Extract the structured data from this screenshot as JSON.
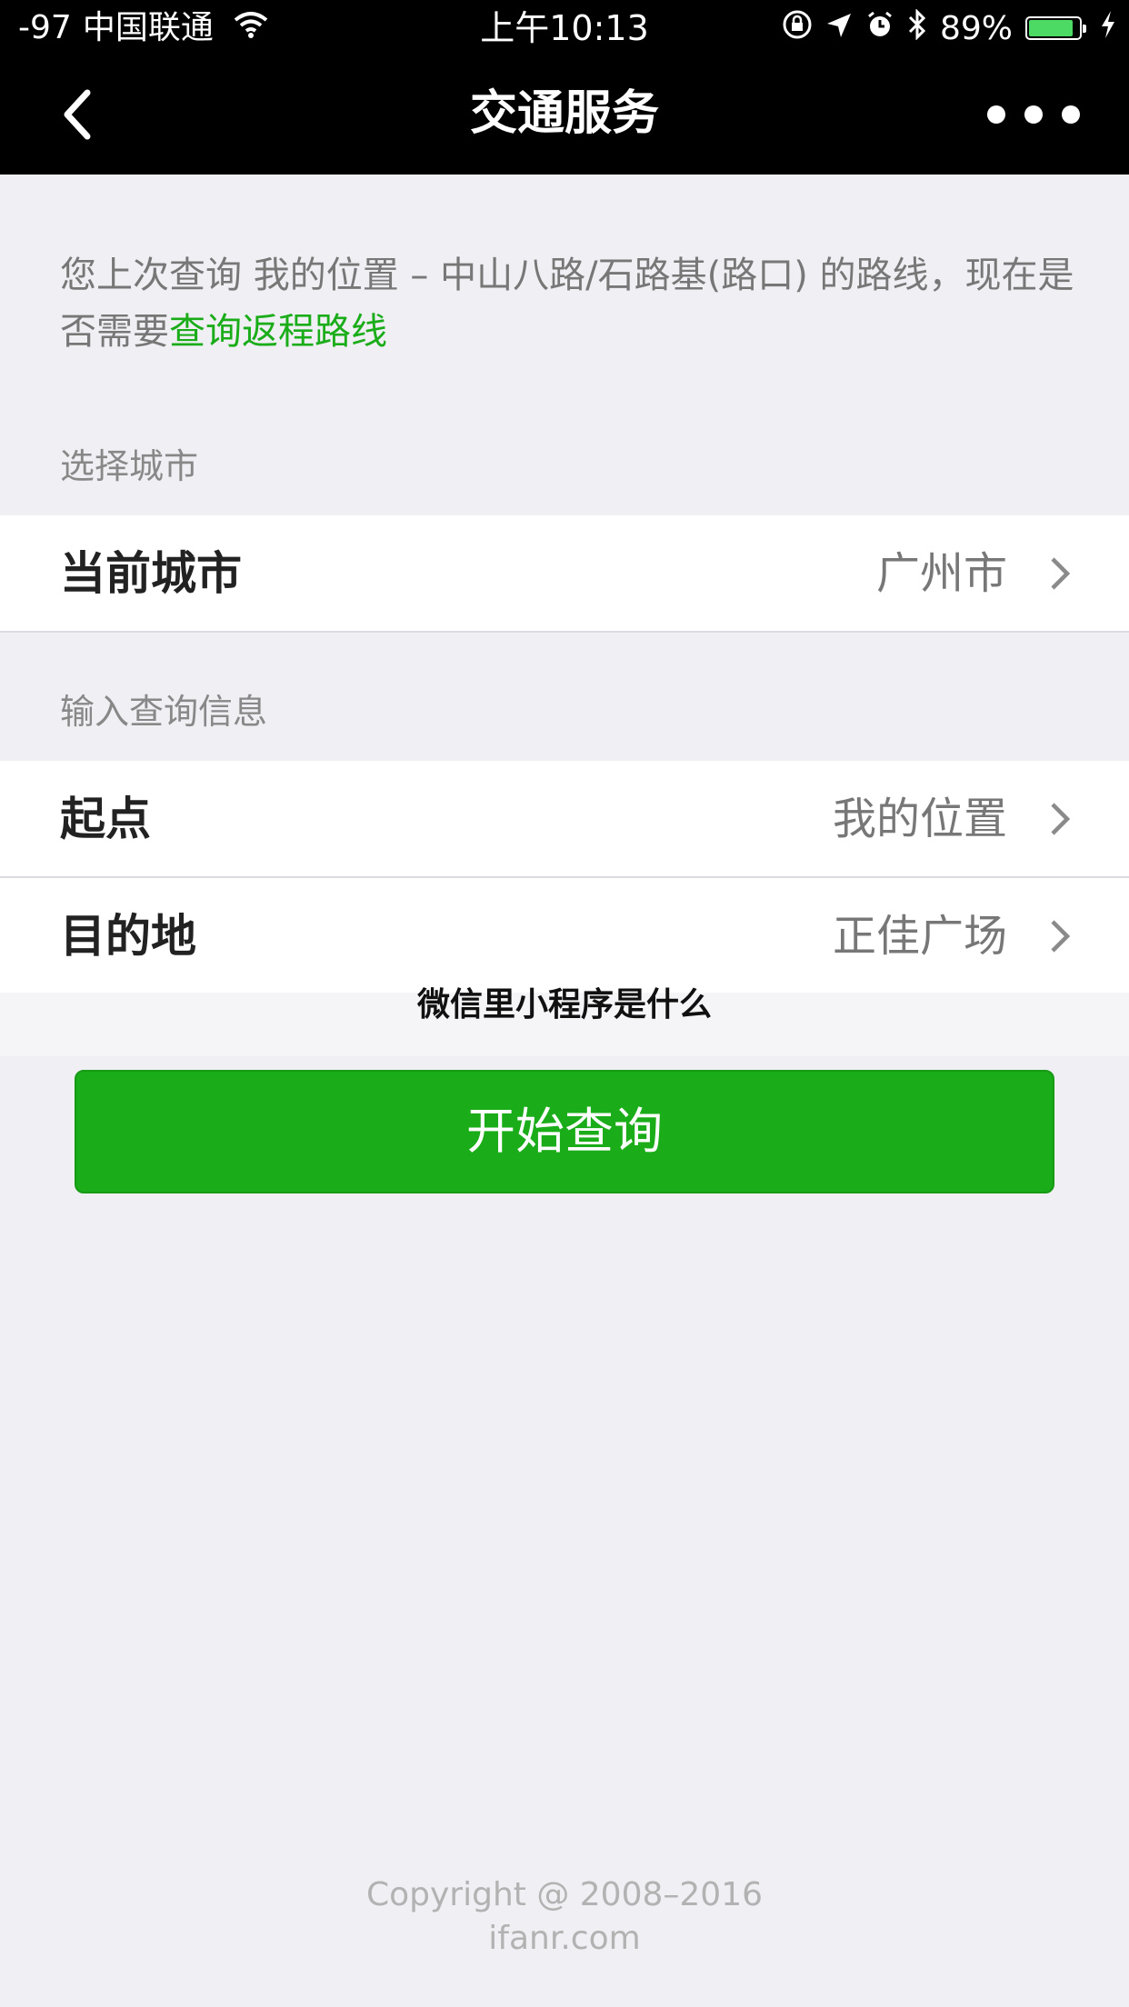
{
  "status_bar": {
    "signal": "-97",
    "carrier": "中国联通",
    "time": "上午10:13",
    "battery": "89%",
    "battery_level": 0.89,
    "battery_color": "#4cd964"
  },
  "nav": {
    "title": "交通服务",
    "back_icon": "chevron-left-icon",
    "more_icon": "more-dots-icon"
  },
  "notice": {
    "text": "您上次查询 我的位置 – 中山八路/石路基(路口) 的路线，现在是否需要",
    "link": "查询返程路线",
    "link_color": "#1aad19"
  },
  "city_section": {
    "label": "选择城市",
    "cell": {
      "name": "当前城市",
      "value": "广州市"
    }
  },
  "query_section": {
    "label": "输入查询信息",
    "start": {
      "name": "起点",
      "value": "我的位置"
    },
    "destination": {
      "name": "目的地",
      "value": "正佳广场"
    }
  },
  "overlay_text": "微信里小程序是什么",
  "primary_button": {
    "label": "开始查询",
    "color": "#1aad19"
  },
  "footer": {
    "copyright": "Copyright @ 2008–2016",
    "site": "ifanr.com"
  }
}
